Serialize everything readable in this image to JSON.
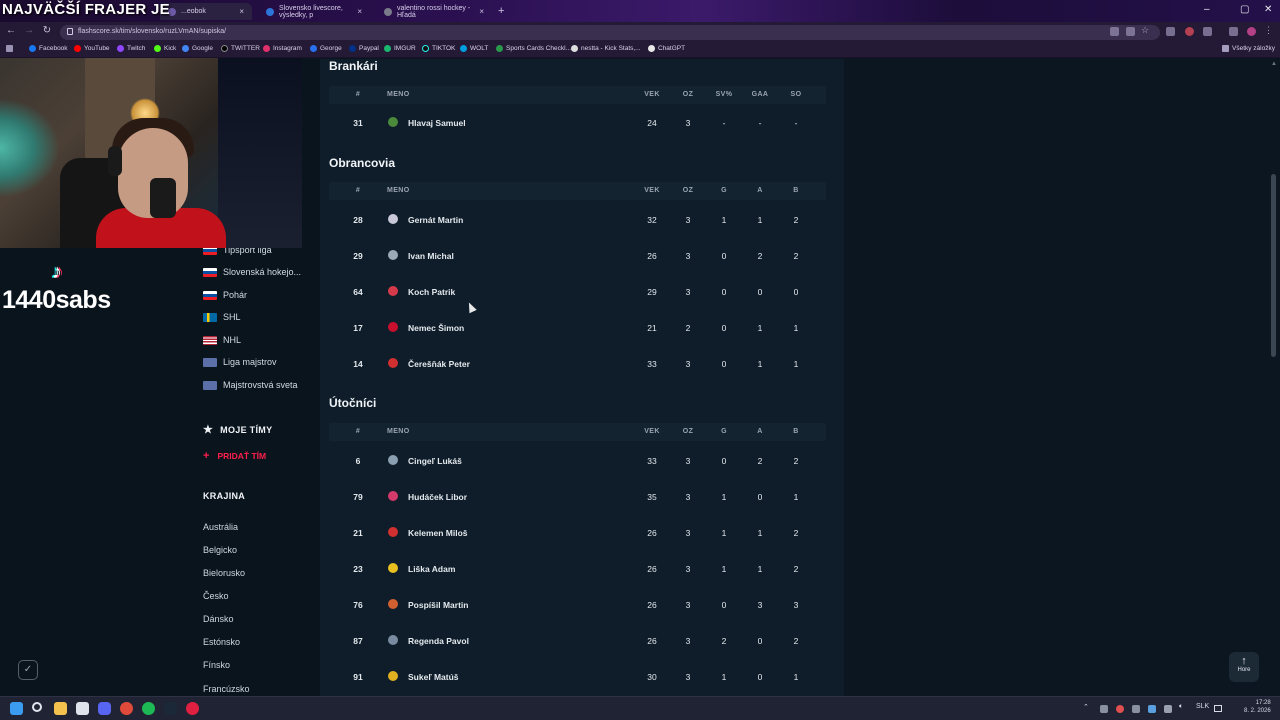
{
  "browser": {
    "tabs": [
      {
        "label": "...eobok",
        "active": true
      },
      {
        "label": "Slovensko livescore, výsledky, p",
        "active": false
      },
      {
        "label": "valentino rossi hockey - Hľadá",
        "active": false
      }
    ],
    "url": "flashscore.sk/tim/slovensko/ruzLVmAN/supiska/",
    "bookmarks": [
      "Facebook",
      "YouTube",
      "Twitch",
      "Kick",
      "Google",
      "TWITTER",
      "Instagram",
      "George",
      "Paypal",
      "IMGUR",
      "TIKTOK",
      "WOLT",
      "Sports Cards Checkl...",
      "nestta - Kick Stats,...",
      "ChatGPT"
    ],
    "all_bookmarks": "Všetky záložky"
  },
  "stream": {
    "title": "NAJVÄČŠÍ FRAJER JE",
    "tiktok_handle": "1440sabs"
  },
  "sidebar": {
    "leagues": [
      {
        "label": "Tipsport liga",
        "flag": "sk"
      },
      {
        "label": "Slovenská hokejo...",
        "flag": "sk"
      },
      {
        "label": "Pohár",
        "flag": "sk"
      },
      {
        "label": "SHL",
        "flag": "se"
      },
      {
        "label": "NHL",
        "flag": "us"
      },
      {
        "label": "Liga majstrov",
        "flag": "world"
      },
      {
        "label": "Majstrovstvá sveta",
        "flag": "world"
      }
    ],
    "my_teams": "MOJE TÍMY",
    "add_team": "PRIDAŤ TÍM",
    "country_heading": "KRAJINA",
    "countries": [
      "Austrália",
      "Belgicko",
      "Bielorusko",
      "Česko",
      "Dánsko",
      "Estónsko",
      "Fínsko",
      "Francúzsko"
    ]
  },
  "roster": {
    "goalies": {
      "title": "Brankári",
      "columns": [
        "#",
        "MENO",
        "VEK",
        "OZ",
        "SV%",
        "GAA",
        "SO"
      ],
      "rows": [
        {
          "num": "31",
          "name": "Hlavaj Samuel",
          "c1": "24",
          "c2": "3",
          "c3": "-",
          "c4": "-",
          "c5": "-",
          "logo": "#4a8a3a"
        }
      ]
    },
    "defense": {
      "title": "Obrancovia",
      "columns": [
        "#",
        "MENO",
        "VEK",
        "OZ",
        "G",
        "A",
        "B"
      ],
      "rows": [
        {
          "num": "28",
          "name": "Gernát Martin",
          "c1": "32",
          "c2": "3",
          "c3": "1",
          "c4": "1",
          "c5": "2",
          "logo": "#c8c8d8"
        },
        {
          "num": "29",
          "name": "Ivan Michal",
          "c1": "26",
          "c2": "3",
          "c3": "0",
          "c4": "2",
          "c5": "2",
          "logo": "#9aa8b8"
        },
        {
          "num": "64",
          "name": "Koch Patrik",
          "c1": "29",
          "c2": "3",
          "c3": "0",
          "c4": "0",
          "c5": "0",
          "logo": "#d43a4a"
        },
        {
          "num": "17",
          "name": "Nemec Šimon",
          "c1": "21",
          "c2": "2",
          "c3": "0",
          "c4": "1",
          "c5": "1",
          "logo": "#c8102e"
        },
        {
          "num": "14",
          "name": "Čerešňák Peter",
          "c1": "33",
          "c2": "3",
          "c3": "0",
          "c4": "1",
          "c5": "1",
          "logo": "#d03030"
        }
      ]
    },
    "forwards": {
      "title": "Útočníci",
      "columns": [
        "#",
        "MENO",
        "VEK",
        "OZ",
        "G",
        "A",
        "B"
      ],
      "rows": [
        {
          "num": "6",
          "name": "Cingeľ Lukáš",
          "c1": "33",
          "c2": "3",
          "c3": "0",
          "c4": "2",
          "c5": "2",
          "logo": "#8aa0b0"
        },
        {
          "num": "79",
          "name": "Hudáček Libor",
          "c1": "35",
          "c2": "3",
          "c3": "1",
          "c4": "0",
          "c5": "1",
          "logo": "#d43a6a"
        },
        {
          "num": "21",
          "name": "Kelemen Miloš",
          "c1": "26",
          "c2": "3",
          "c3": "1",
          "c4": "1",
          "c5": "2",
          "logo": "#d03030"
        },
        {
          "num": "23",
          "name": "Liška Adam",
          "c1": "26",
          "c2": "3",
          "c3": "1",
          "c4": "1",
          "c5": "2",
          "logo": "#e8c020"
        },
        {
          "num": "76",
          "name": "Pospíšil Martin",
          "c1": "26",
          "c2": "3",
          "c3": "0",
          "c4": "3",
          "c5": "3",
          "logo": "#d06030"
        },
        {
          "num": "87",
          "name": "Regenda Pavol",
          "c1": "26",
          "c2": "3",
          "c3": "2",
          "c4": "0",
          "c5": "2",
          "logo": "#7a8aa0"
        },
        {
          "num": "91",
          "name": "Sukeľ Matúš",
          "c1": "30",
          "c2": "3",
          "c3": "1",
          "c4": "0",
          "c5": "1",
          "logo": "#e0b020"
        }
      ]
    }
  },
  "scroll_top_label": "Hore",
  "taskbar": {
    "lang": "SLK",
    "time": "17:28",
    "date": "8. 2. 2026"
  },
  "colors": {
    "accent_red": "#ff1f4b",
    "page_bg": "#0b1620",
    "content_bg": "#0e1d29"
  }
}
